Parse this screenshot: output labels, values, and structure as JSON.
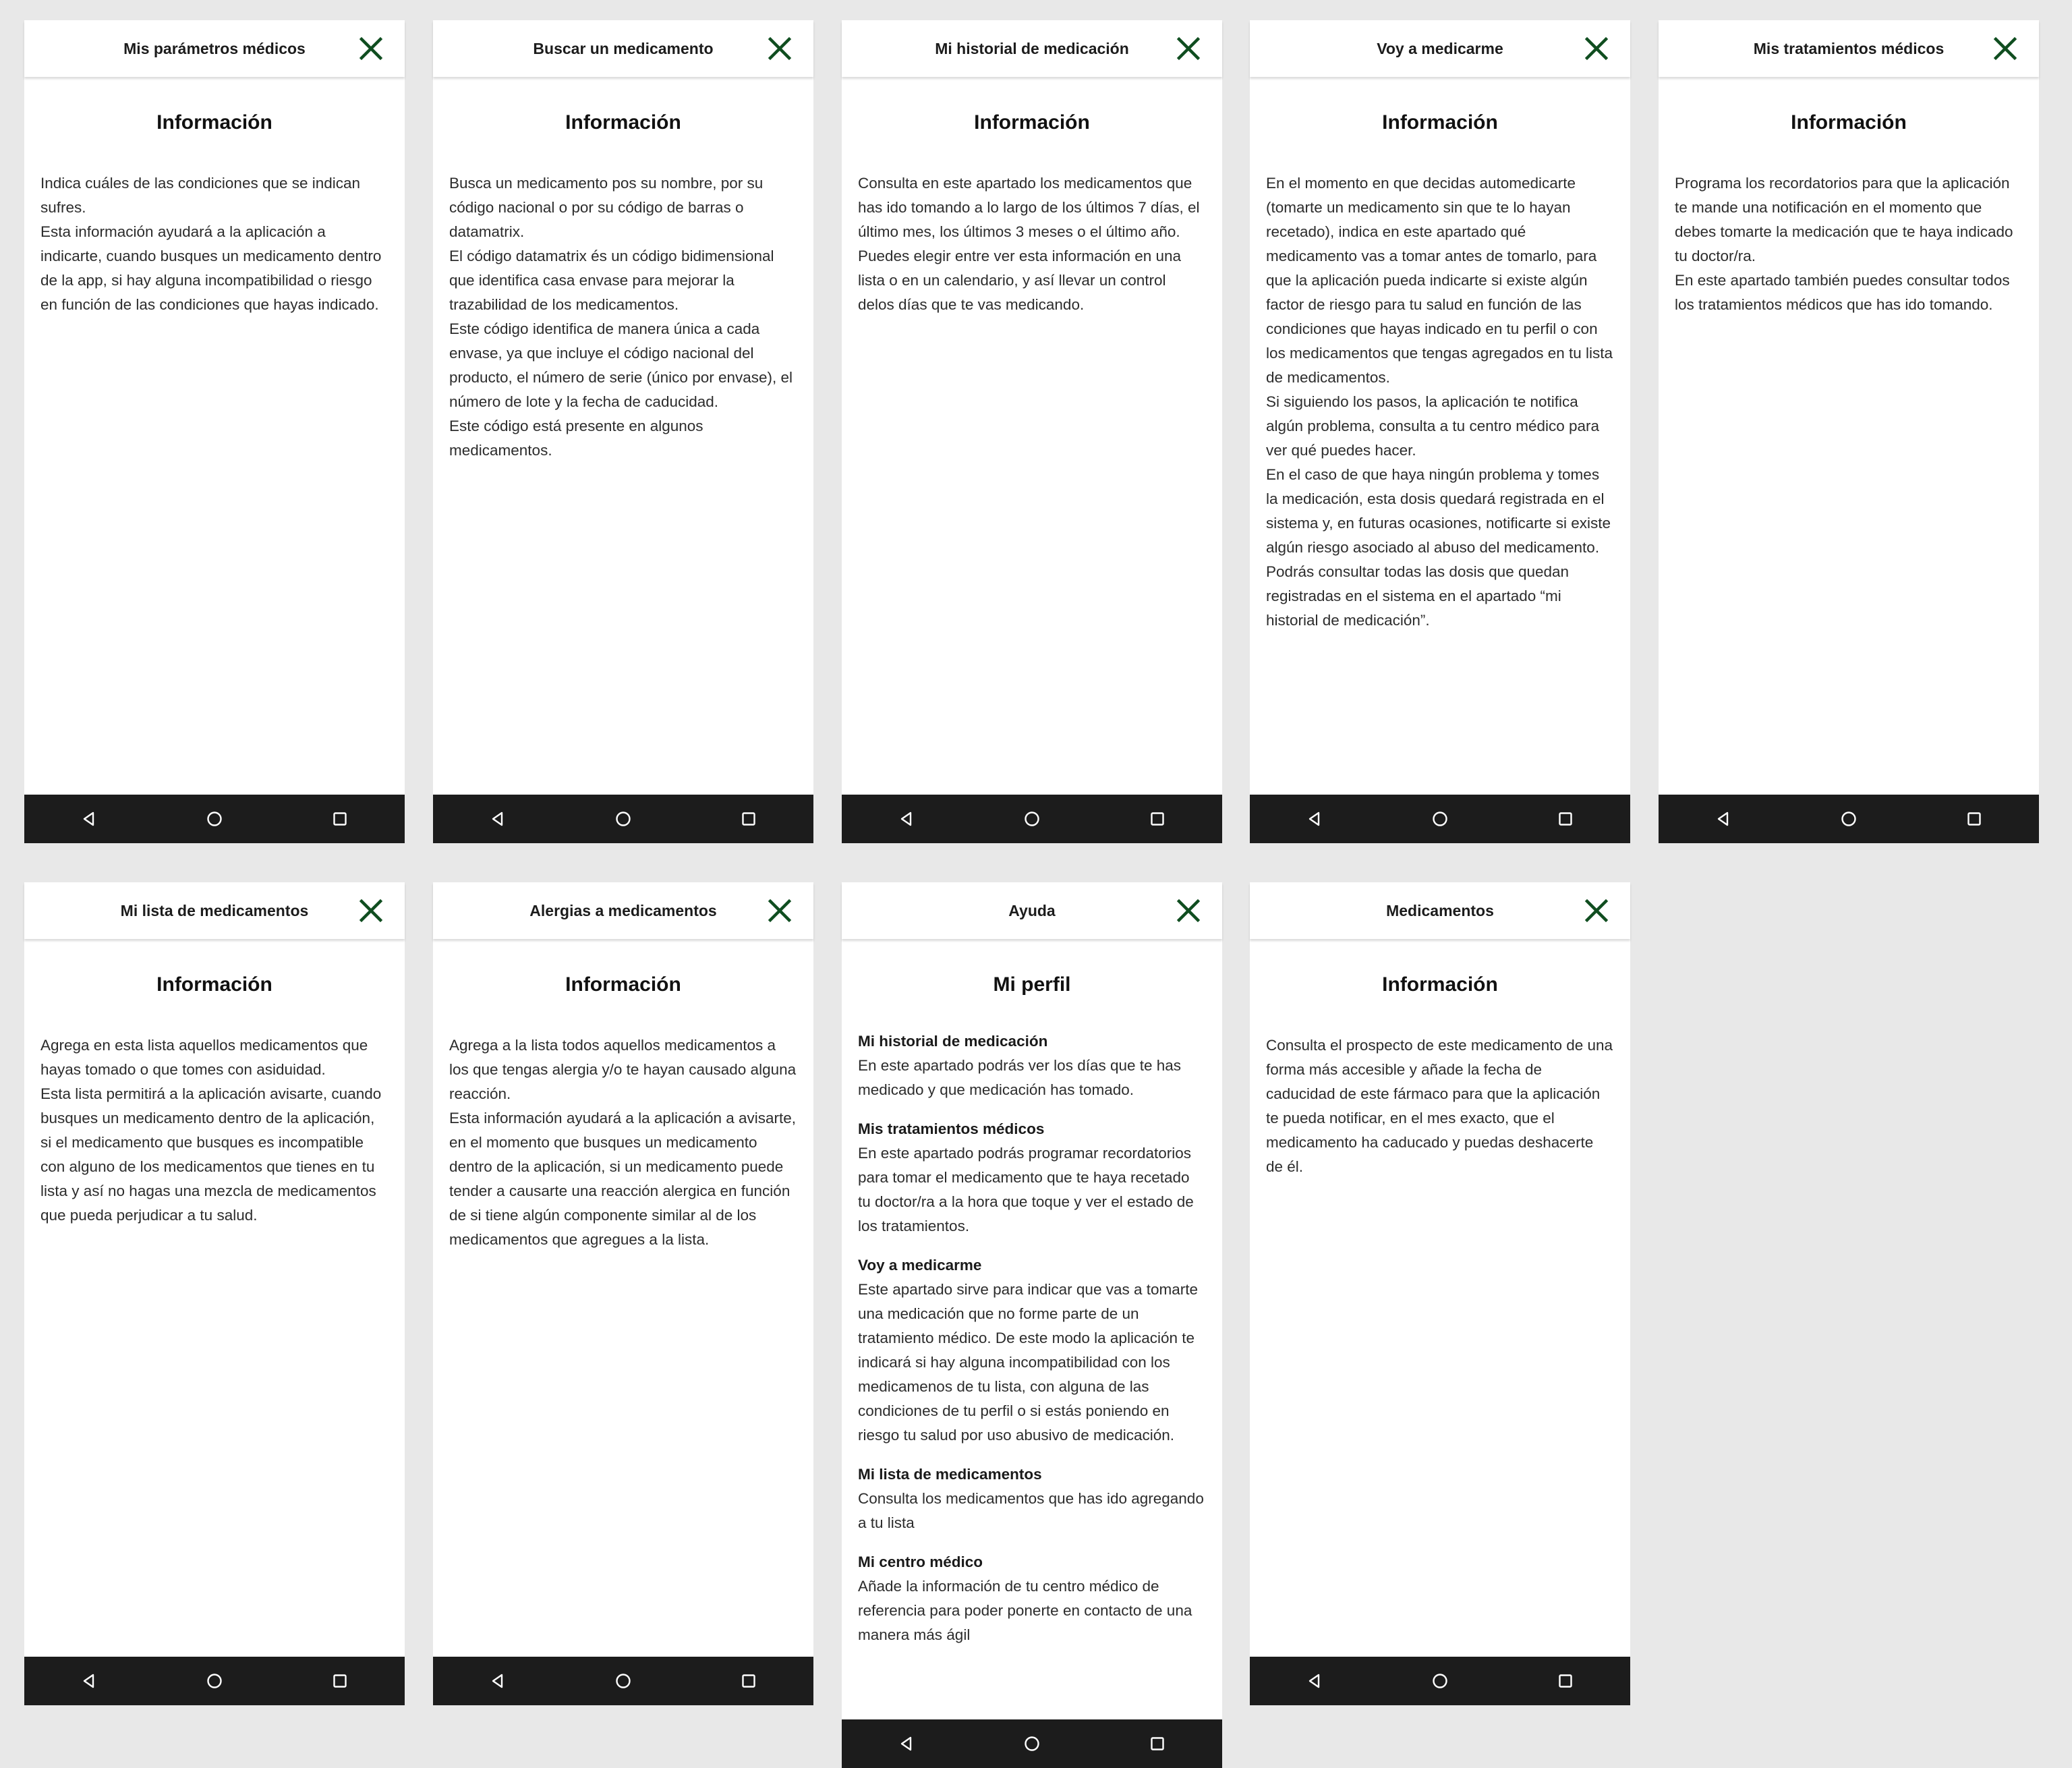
{
  "colors": {
    "background": "#e8e8e8",
    "card": "#ffffff",
    "close_icon": "#0f4d1f",
    "navbar": "#1c1c1c",
    "nav_icon": "#ffffff"
  },
  "icons": {
    "close": "close-icon",
    "back": "back-triangle-icon",
    "home": "home-circle-icon",
    "recents": "recents-square-icon"
  },
  "screens": [
    {
      "header_title": "Mis parámetros médicos",
      "info_title": "Información",
      "text": "Indica cuáles de las condiciones que se indican sufres.\nEsta información ayudará a la aplicación a indicarte, cuando busques un medicamento dentro de la app, si hay alguna incompatibilidad o riesgo en función de las condiciones que hayas indicado."
    },
    {
      "header_title": "Buscar un medicamento",
      "info_title": "Información",
      "text": "Busca un medicamento pos su nombre, por su código nacional o por su código de barras o datamatrix.\nEl código datamatrix és un código bidimensional que identifica casa envase para mejorar la trazabilidad de los medicamentos.\nEste código identifica de manera única a cada envase, ya que incluye el código nacional del producto, el número de serie (único por envase), el número de lote y la fecha de caducidad.\nEste código  está presente en algunos medicamentos."
    },
    {
      "header_title": "Mi historial de medicación",
      "info_title": "Información",
      "text": "Consulta en este apartado los medicamentos que has ido tomando a lo largo de los últimos 7 días, el último mes, los últimos 3 meses o el último año.\nPuedes elegir entre ver esta información en una lista o en un calendario, y así llevar un control delos días que te vas medicando."
    },
    {
      "header_title": "Voy a medicarme",
      "info_title": "Información",
      "text": "En el momento en que decidas automedicarte (tomarte un medicamento sin que te lo hayan recetado), indica en este apartado qué medicamento vas a tomar antes de tomarlo, para que la aplicación pueda indicarte si existe algún factor de riesgo para tu salud en función de las condiciones que hayas indicado en tu perfil o con los medicamentos que tengas agregados en tu lista de medicamentos.\nSi siguiendo los pasos, la aplicación te notifica algún problema, consulta a tu centro médico para ver qué puedes hacer.\nEn el caso de que haya ningún problema y tomes la medicación, esta dosis quedará registrada en el sistema y, en futuras ocasiones, notificarte si existe algún riesgo asociado al abuso del medicamento.\nPodrás consultar todas las dosis que quedan registradas en el sistema en el apartado “mi historial de medicación”."
    },
    {
      "header_title": "Mis tratamientos médicos",
      "info_title": "Información",
      "text": "Programa los recordatorios para que la aplicación te mande una notificación en el momento que debes tomarte la medicación que te haya indicado tu doctor/ra.\nEn este apartado también puedes consultar todos los tratamientos médicos que has ido tomando."
    },
    {
      "header_title": "Mi lista de medicamentos",
      "info_title": "Información",
      "text": "Agrega en esta lista aquellos medicamentos que hayas tomado o que tomes con asiduidad.\nEsta lista permitirá a la aplicación avisarte, cuando busques un medicamento dentro de la aplicación, si el medicamento que busques es incompatible con alguno de los medicamentos que tienes en tu lista y así no hagas una mezcla de medicamentos que pueda perjudicar a tu salud."
    },
    {
      "header_title": "Alergias a medicamentos",
      "info_title": "Información",
      "text": "Agrega a la lista todos aquellos medicamentos a los que tengas alergia y/o te hayan causado alguna reacción.\nEsta información ayudará a la aplicación a avisarte, en el momento que busques un medicamento dentro de la aplicación, si un medicamento puede tender a causarte una reacción alergica en función de si tiene algún componente similar al de los medicamentos que agregues a la lista."
    },
    {
      "header_title": "Ayuda",
      "info_title": "Mi perfil",
      "sections": [
        {
          "title": "Mi historial de medicación",
          "text": "En este apartado podrás ver los días que te has medicado y que medicación has tomado."
        },
        {
          "title": "Mis tratamientos médicos",
          "text": "En este apartado podrás programar recordatorios para tomar el medicamento que te haya recetado tu doctor/ra a la hora que toque y ver el estado de los tratamientos."
        },
        {
          "title": "Voy a medicarme",
          "text": "Este apartado sirve para indicar que vas a tomarte una medicación que no forme parte de un tratamiento médico. De este modo la aplicación te indicará si hay alguna incompatibilidad con los medicamenos de tu lista, con alguna de las condiciones de tu perfil o si estás poniendo en riesgo tu salud por uso abusivo de medicación."
        },
        {
          "title": "Mi lista de medicamentos",
          "text": "Consulta los medicamentos que has ido agregando a tu lista"
        },
        {
          "title": "Mi centro médico",
          "text": "Añade la información de tu centro médico de referencia para poder ponerte en contacto de una manera más ágil"
        }
      ]
    },
    {
      "header_title": "Medicamentos",
      "info_title": "Información",
      "text": "Consulta el prospecto de este medicamento de una forma más accesible y añade la fecha de caducidad de este fármaco para que la aplicación te pueda notificar, en el mes exacto, que el medicamento ha caducado y puedas deshacerte de él."
    }
  ]
}
